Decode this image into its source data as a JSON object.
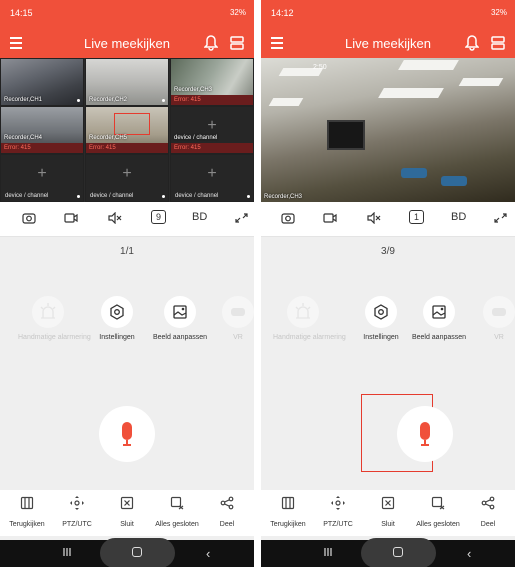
{
  "colors": {
    "accent": "#f0503a",
    "error": "#ff6a5a",
    "highlight": "#e53b2e"
  },
  "left": {
    "status": {
      "time": "14:15",
      "battery": "32%"
    },
    "title": "Live meekijken",
    "cameras": [
      {
        "label": "Recorder,CH1",
        "error": ""
      },
      {
        "label": "Recorder,CH2",
        "error": ""
      },
      {
        "label": "Recorder,CH3",
        "error": "Error: 415"
      },
      {
        "label": "Recorder,CH4",
        "error": "Error: 415"
      },
      {
        "label": "Recorder,CH5",
        "error": "Error: 415"
      },
      {
        "label": "device / channel",
        "error": "Error: 415"
      }
    ],
    "empty_cells": [
      "device / channel",
      "device / channel",
      "device / channel"
    ],
    "controls": {
      "split": "9",
      "quality": "BD"
    },
    "page": "1/1",
    "features": [
      {
        "label": "Handmatige alarmering",
        "icon": "siren-icon",
        "enabled": false
      },
      {
        "label": "Instellingen",
        "icon": "settings-hexagon-icon",
        "enabled": true
      },
      {
        "label": "Beeld aanpassen",
        "icon": "image-adjust-icon",
        "enabled": true
      },
      {
        "label": "VR",
        "icon": "vr-icon",
        "enabled": false
      }
    ],
    "bottom": [
      {
        "label": "Terugkijken",
        "icon": "playback-icon"
      },
      {
        "label": "PTZ/UTC",
        "icon": "ptz-icon"
      },
      {
        "label": "Sluit",
        "icon": "close-box-icon"
      },
      {
        "label": "Alles gesloten",
        "icon": "close-all-icon"
      },
      {
        "label": "Deel",
        "icon": "share-icon"
      }
    ]
  },
  "right": {
    "status": {
      "time": "14:12",
      "battery": "32%"
    },
    "title": "Live meekijken",
    "camera_label": "Recorder,CH3",
    "camera_time": "2:50",
    "controls": {
      "split": "1",
      "quality": "BD"
    },
    "page": "3/9",
    "features": [
      {
        "label": "Handmatige alarmering",
        "icon": "siren-icon",
        "enabled": false
      },
      {
        "label": "Instellingen",
        "icon": "settings-hexagon-icon",
        "enabled": true
      },
      {
        "label": "Beeld aanpassen",
        "icon": "image-adjust-icon",
        "enabled": true
      },
      {
        "label": "VR",
        "icon": "vr-icon",
        "enabled": false
      }
    ],
    "bottom": [
      {
        "label": "Terugkijken",
        "icon": "playback-icon"
      },
      {
        "label": "PTZ/UTC",
        "icon": "ptz-icon"
      },
      {
        "label": "Sluit",
        "icon": "close-box-icon"
      },
      {
        "label": "Alles gesloten",
        "icon": "close-all-icon"
      },
      {
        "label": "Deel",
        "icon": "share-icon"
      }
    ]
  }
}
